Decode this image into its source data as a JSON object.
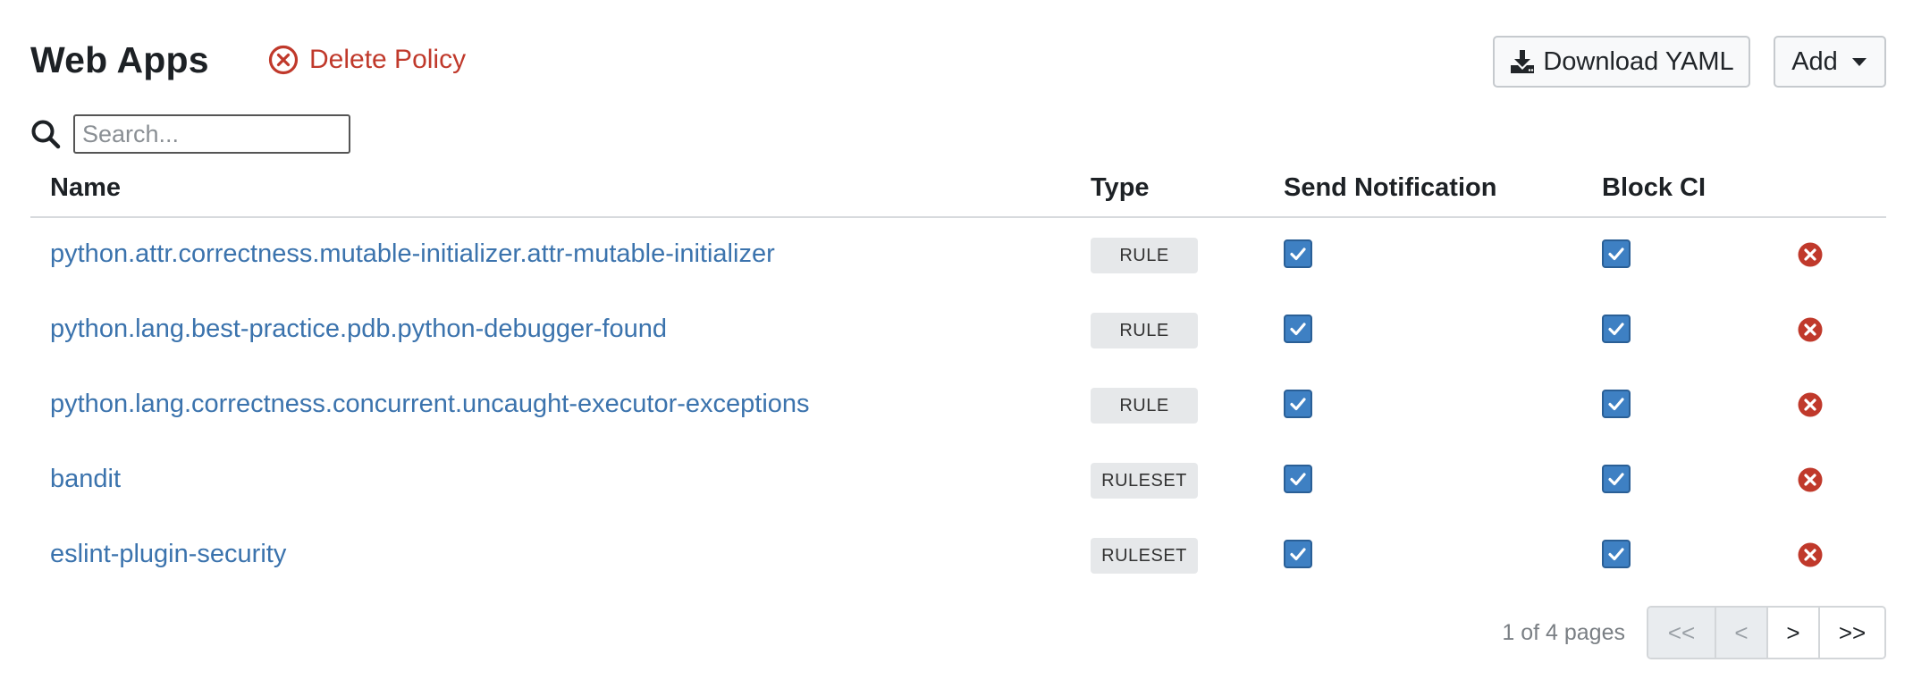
{
  "header": {
    "title": "Web Apps",
    "delete_label": "Delete Policy",
    "download_label": "Download YAML",
    "add_label": "Add"
  },
  "search": {
    "placeholder": "Search...",
    "value": ""
  },
  "table": {
    "columns": [
      "Name",
      "Type",
      "Send Notification",
      "Block CI"
    ],
    "rows": [
      {
        "name": "python.attr.correctness.mutable-initializer.attr-mutable-initializer",
        "type": "RULE",
        "send_notification": true,
        "block_ci": true
      },
      {
        "name": "python.lang.best-practice.pdb.python-debugger-found",
        "type": "RULE",
        "send_notification": true,
        "block_ci": true
      },
      {
        "name": "python.lang.correctness.concurrent.uncaught-executor-exceptions",
        "type": "RULE",
        "send_notification": true,
        "block_ci": true
      },
      {
        "name": "bandit",
        "type": "RULESET",
        "send_notification": true,
        "block_ci": true
      },
      {
        "name": "eslint-plugin-security",
        "type": "RULESET",
        "send_notification": true,
        "block_ci": true
      }
    ]
  },
  "pagination": {
    "info": "1 of 4 pages",
    "first_label": "<<",
    "prev_label": "<",
    "next_label": ">",
    "last_label": ">>"
  },
  "colors": {
    "link": "#3b73ad",
    "danger": "#c0392b",
    "checkbox": "#3e80c3",
    "badge_bg": "#e6e8ea"
  },
  "icons": {
    "delete": "circle-x-icon",
    "download": "download-icon",
    "dropdown": "caret-down-icon",
    "search": "search-icon",
    "checkbox": "check-icon",
    "remove": "remove-circle-icon"
  }
}
